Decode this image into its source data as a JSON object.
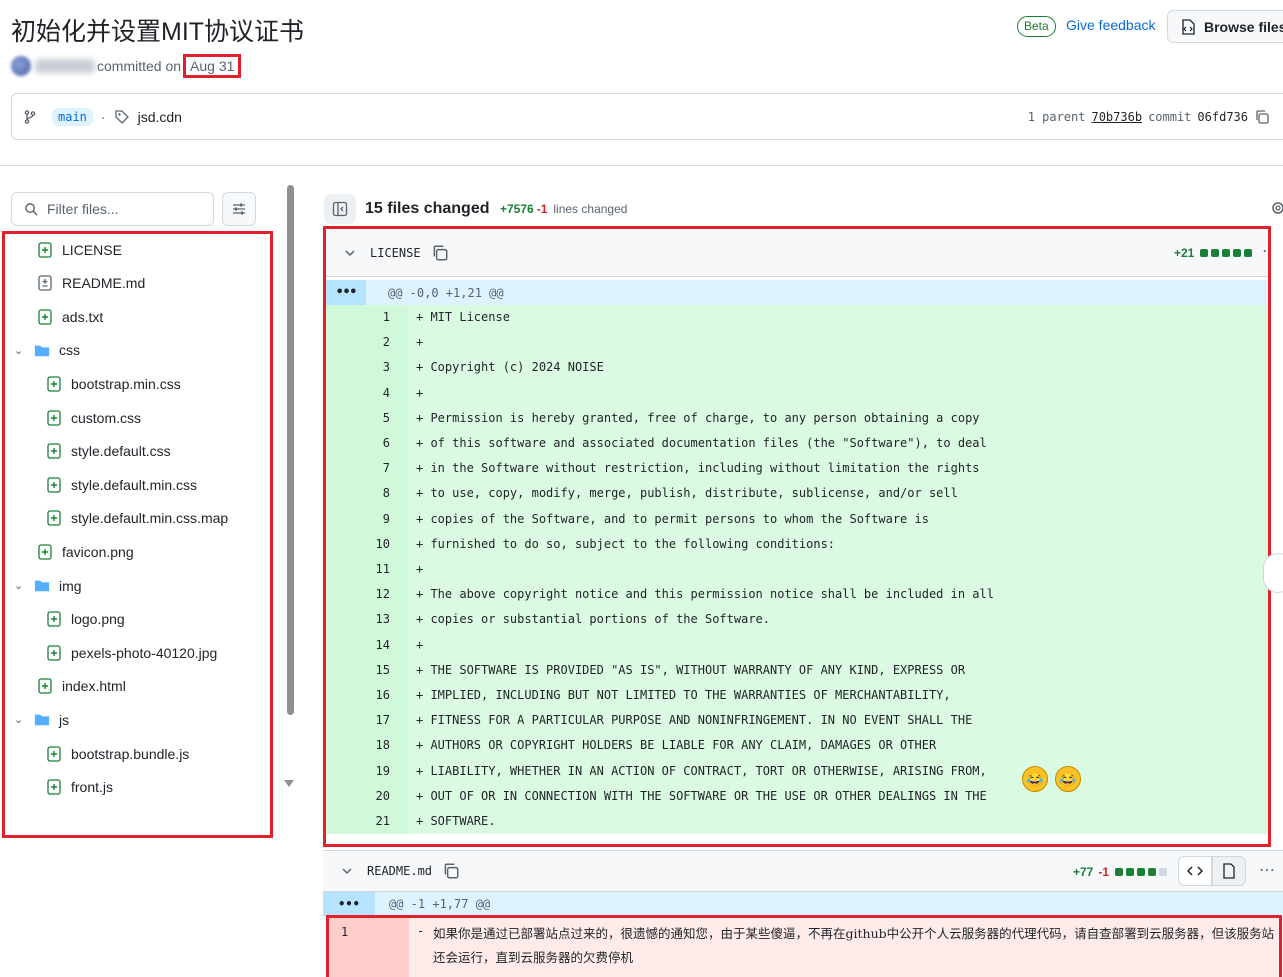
{
  "commit": {
    "title": "初始化并设置MIT协议证书",
    "committed_text": "committed on",
    "date": "Aug 31",
    "beta_badge": "Beta",
    "feedback_label": "Give feedback",
    "browse_label": "Browse files"
  },
  "branch_bar": {
    "branch": "main",
    "separator": "·",
    "tag": "jsd.cdn",
    "parent_label": "1 parent",
    "parent_hash": "70b736b",
    "commit_label": "commit",
    "commit_hash": "06fd736"
  },
  "sidebar": {
    "filter_placeholder": "Filter files...",
    "tree": [
      {
        "label": "LICENSE",
        "icon": "file-added-icon",
        "depth": 0
      },
      {
        "label": "README.md",
        "icon": "file-modified-icon",
        "depth": 0
      },
      {
        "label": "ads.txt",
        "icon": "file-added-icon",
        "depth": 0
      },
      {
        "label": "css",
        "icon": "folder-icon",
        "depth": 0,
        "folder": true
      },
      {
        "label": "bootstrap.min.css",
        "icon": "file-added-icon",
        "depth": 1
      },
      {
        "label": "custom.css",
        "icon": "file-added-icon",
        "depth": 1
      },
      {
        "label": "style.default.css",
        "icon": "file-added-icon",
        "depth": 1
      },
      {
        "label": "style.default.min.css",
        "icon": "file-added-icon",
        "depth": 1
      },
      {
        "label": "style.default.min.css.map",
        "icon": "file-added-icon",
        "depth": 1
      },
      {
        "label": "favicon.png",
        "icon": "file-added-icon",
        "depth": 0
      },
      {
        "label": "img",
        "icon": "folder-icon",
        "depth": 0,
        "folder": true
      },
      {
        "label": "logo.png",
        "icon": "file-added-icon",
        "depth": 1
      },
      {
        "label": "pexels-photo-40120.jpg",
        "icon": "file-added-icon",
        "depth": 1
      },
      {
        "label": "index.html",
        "icon": "file-added-icon",
        "depth": 0
      },
      {
        "label": "js",
        "icon": "folder-icon",
        "depth": 0,
        "folder": true
      },
      {
        "label": "bootstrap.bundle.js",
        "icon": "file-added-icon",
        "depth": 1
      },
      {
        "label": "front.js",
        "icon": "file-added-icon",
        "depth": 1
      }
    ]
  },
  "summary": {
    "files_changed": "15 files changed",
    "additions": "+7576",
    "deletions": "-1",
    "lines_changed": "lines changed"
  },
  "file1": {
    "name": "LICENSE",
    "additions": "+21",
    "expander": "•••",
    "hunk": "@@ -0,0 +1,21 @@",
    "lines": [
      {
        "n": "1",
        "text": "+ MIT License"
      },
      {
        "n": "2",
        "text": "+"
      },
      {
        "n": "3",
        "text": "+ Copyright (c) 2024 NOISE"
      },
      {
        "n": "4",
        "text": "+"
      },
      {
        "n": "5",
        "text": "+ Permission is hereby granted, free of charge, to any person obtaining a copy"
      },
      {
        "n": "6",
        "text": "+ of this software and associated documentation files (the \"Software\"), to deal"
      },
      {
        "n": "7",
        "text": "+ in the Software without restriction, including without limitation the rights"
      },
      {
        "n": "8",
        "text": "+ to use, copy, modify, merge, publish, distribute, sublicense, and/or sell"
      },
      {
        "n": "9",
        "text": "+ copies of the Software, and to permit persons to whom the Software is"
      },
      {
        "n": "10",
        "text": "+ furnished to do so, subject to the following conditions:"
      },
      {
        "n": "11",
        "text": "+"
      },
      {
        "n": "12",
        "text": "+ The above copyright notice and this permission notice shall be included in all"
      },
      {
        "n": "13",
        "text": "+ copies or substantial portions of the Software."
      },
      {
        "n": "14",
        "text": "+"
      },
      {
        "n": "15",
        "text": "+ THE SOFTWARE IS PROVIDED \"AS IS\", WITHOUT WARRANTY OF ANY KIND, EXPRESS OR"
      },
      {
        "n": "16",
        "text": "+ IMPLIED, INCLUDING BUT NOT LIMITED TO THE WARRANTIES OF MERCHANTABILITY,"
      },
      {
        "n": "17",
        "text": "+ FITNESS FOR A PARTICULAR PURPOSE AND NONINFRINGEMENT. IN NO EVENT SHALL THE"
      },
      {
        "n": "18",
        "text": "+ AUTHORS OR COPYRIGHT HOLDERS BE LIABLE FOR ANY CLAIM, DAMAGES OR OTHER"
      },
      {
        "n": "19",
        "text": "+ LIABILITY, WHETHER IN AN ACTION OF CONTRACT, TORT OR OTHERWISE, ARISING FROM,"
      },
      {
        "n": "20",
        "text": "+ OUT OF OR IN CONNECTION WITH THE SOFTWARE OR THE USE OR OTHER DEALINGS IN THE"
      },
      {
        "n": "21",
        "text": "+ SOFTWARE."
      }
    ]
  },
  "file2": {
    "name": "README.md",
    "additions": "+77",
    "deletions": "-1",
    "expander": "•••",
    "hunk": "@@ -1 +1,77 @@",
    "deleted_line_number": "1",
    "deleted_sign": "-",
    "deleted_text": "如果你是通过已部署站点过来的，很遗憾的通知您，由于某些傻逼，不再在github中公开个人云服务器的代理代码，请自查部署到云服务器，但该服务站还会运行，直到云服务器的欠费停机"
  },
  "colors": {
    "add_green": "#1a7f37",
    "delete_red": "#d1242f",
    "highlight_box": "#e0202a",
    "link_blue": "#0969da"
  }
}
